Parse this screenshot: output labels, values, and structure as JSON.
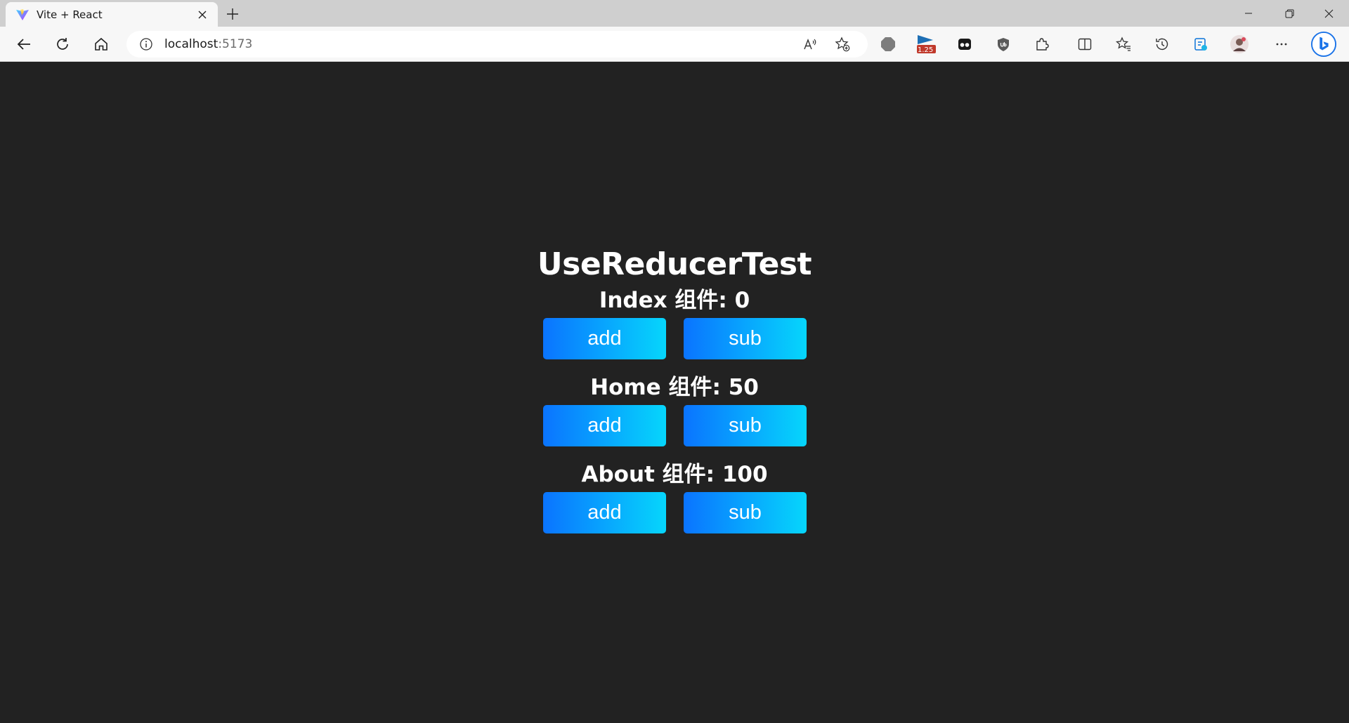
{
  "browser": {
    "tab_title": "Vite + React",
    "url_host": "localhost",
    "url_port": ":5173",
    "extension_badge": "1.25"
  },
  "app": {
    "title": "UseReducerTest",
    "counters": [
      {
        "label": "Index 组件: 0",
        "add_label": "add",
        "sub_label": "sub"
      },
      {
        "label": "Home 组件: 50",
        "add_label": "add",
        "sub_label": "sub"
      },
      {
        "label": "About 组件: 100",
        "add_label": "add",
        "sub_label": "sub"
      }
    ]
  },
  "colors": {
    "background": "#222222",
    "button_gradient_start": "#0a74ff",
    "button_gradient_end": "#06d6fc"
  }
}
